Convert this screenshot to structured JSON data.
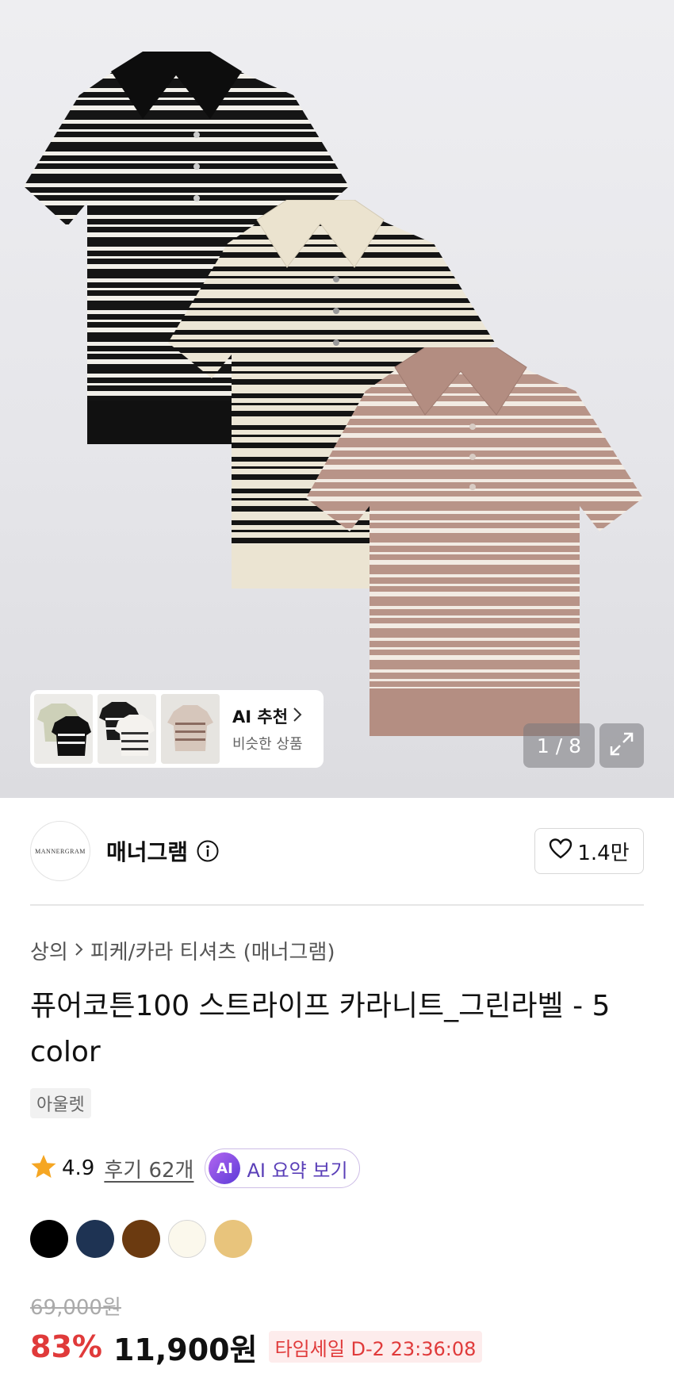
{
  "hero": {
    "ai_card": {
      "title": "AI 추천",
      "subtitle": "비슷한 상품"
    },
    "page_counter": "1 / 8"
  },
  "brand": {
    "logo_text": "MANNERGRAM",
    "name": "매너그램",
    "likes": "1.4만"
  },
  "breadcrumb": {
    "category": "상의",
    "subcategory": "피케/카라 티셔츠 (매너그램)"
  },
  "product": {
    "title": "퓨어코튼100 스트라이프 카라니트_그린라벨 - 5 color",
    "badge": "아울렛",
    "rating": "4.9",
    "reviews": "후기 62개",
    "ai_summary_badge": "AI",
    "ai_summary_label": "AI 요약 보기"
  },
  "colors": [
    "#000000",
    "#1e3353",
    "#6b3a10",
    "#fbf8ec",
    "#e8c47c"
  ],
  "pricing": {
    "original": "69,000원",
    "discount": "83%",
    "price": "11,900원",
    "timesale": "타임세일 D-2 23:36:08"
  }
}
